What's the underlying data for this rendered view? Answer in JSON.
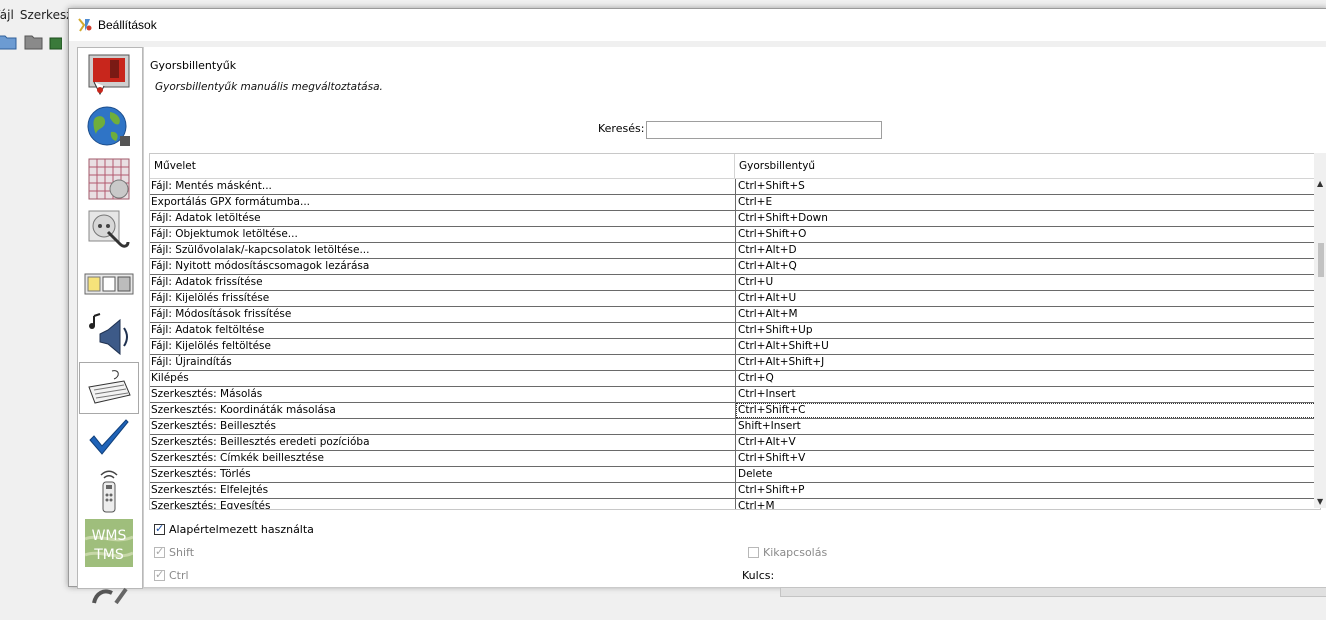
{
  "background_app": {
    "menu": [
      "Fájl",
      "Szerkeszt"
    ]
  },
  "dialog": {
    "title": "Beállítások",
    "categories": [
      {
        "icon": "display-preferences-icon"
      },
      {
        "icon": "globe-icon"
      },
      {
        "icon": "grid-projection-icon"
      },
      {
        "icon": "plug-connection-icon"
      },
      {
        "icon": "toolbar-icon"
      },
      {
        "icon": "audio-speaker-icon"
      },
      {
        "icon": "keyboard-icon",
        "selected": true
      },
      {
        "icon": "validator-checkmark-icon"
      },
      {
        "icon": "remote-control-icon"
      },
      {
        "icon": "wms-tms-icon",
        "label": "WMS\nTMS"
      },
      {
        "icon": "tools-icon"
      }
    ]
  },
  "shortcuts": {
    "heading": "Gyorsbillentyűk",
    "description": "Gyorsbillentyűk manuális megváltoztatása.",
    "search_label": "Keresés:",
    "search_value": "",
    "columns": [
      "Művelet",
      "Gyorsbillentyű"
    ],
    "rows": [
      [
        "Fájl: Mentés másként...",
        "Ctrl+Shift+S"
      ],
      [
        "Exportálás GPX formátumba...",
        "Ctrl+E"
      ],
      [
        "Fájl: Adatok letöltése",
        "Ctrl+Shift+Down"
      ],
      [
        "Fájl: Objektumok letöltése...",
        "Ctrl+Shift+O"
      ],
      [
        "Fájl: Szülővolalak/-kapcsolatok letöltése...",
        "Ctrl+Alt+D"
      ],
      [
        "Fájl: Nyitott módosításcsomagok lezárása",
        "Ctrl+Alt+Q"
      ],
      [
        "Fájl: Adatok frissítése",
        "Ctrl+U"
      ],
      [
        "Fájl: Kijelölés frissítése",
        "Ctrl+Alt+U"
      ],
      [
        "Fájl: Módosítások frissítése",
        "Ctrl+Alt+M"
      ],
      [
        "Fájl: Adatok feltöltése",
        "Ctrl+Shift+Up"
      ],
      [
        "Fájl: Kijelölés feltöltése",
        "Ctrl+Alt+Shift+U"
      ],
      [
        "Fájl: Újraindítás",
        "Ctrl+Alt+Shift+J"
      ],
      [
        "Kilépés",
        "Ctrl+Q"
      ],
      [
        "Szerkesztés: Másolás",
        "Ctrl+Insert"
      ],
      [
        "Szerkesztés: Koordináták másolása",
        "Ctrl+Shift+C"
      ],
      [
        "Szerkesztés: Beillesztés",
        "Shift+Insert"
      ],
      [
        "Szerkesztés: Beillesztés eredeti pozícióba",
        "Ctrl+Alt+V"
      ],
      [
        "Szerkesztés: Címkék beillesztése",
        "Ctrl+Shift+V"
      ],
      [
        "Szerkesztés: Törlés",
        "Delete"
      ],
      [
        "Szerkesztés: Elfelejtés",
        "Ctrl+Shift+P"
      ],
      [
        "Szerkesztés: Egyesítés",
        "Ctrl+M"
      ]
    ],
    "use_default_label": "Alapértelmezett használta",
    "use_default_checked": true,
    "shift_label": "Shift",
    "ctrl_label": "Ctrl",
    "disable_label": "Kikapcsolás",
    "key_label": "Kulcs:"
  }
}
